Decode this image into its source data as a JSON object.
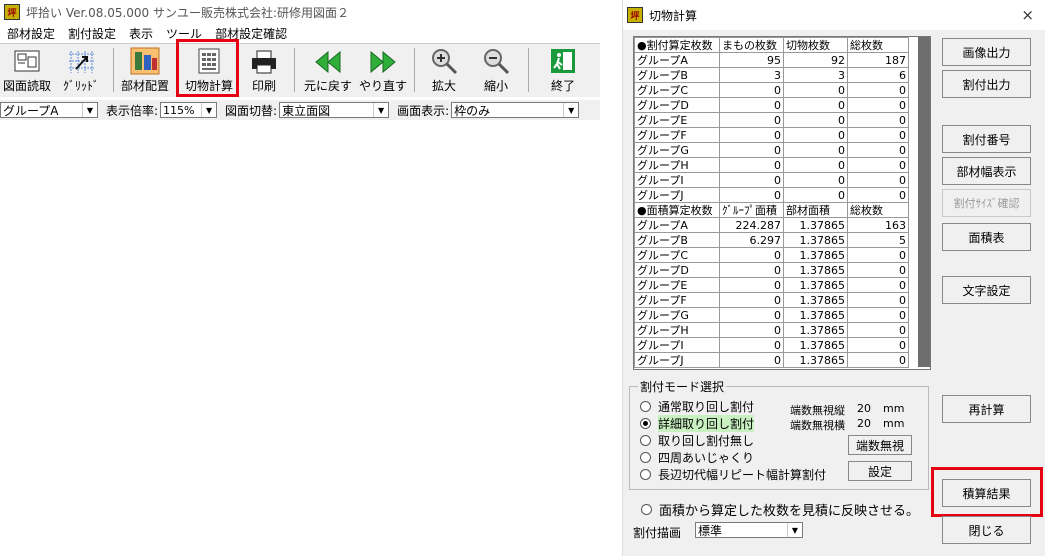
{
  "main": {
    "title": "坪拾い Ver.08.05.000 サンユー販売株式会社:研修用図面２",
    "menu": [
      "部材設定",
      "割付設定",
      "表示",
      "ツール",
      "部材設定確認"
    ],
    "toolbar": {
      "zumen_yomitori": "図面読取",
      "grid": "ｸﾞﾘｯﾄﾞ",
      "buzai_haichi": "部材配置",
      "kiributsu_keisan": "切物計算",
      "insatsu": "印刷",
      "moto_ni_modosu": "元に戻す",
      "yarinaosu": "やり直す",
      "kakudai": "拡大",
      "shukusho": "縮小",
      "shuryo": "終了"
    },
    "group_select": "グループA",
    "scale_label": "表示倍率:",
    "scale_value": "115%",
    "view_switch_label": "図面切替:",
    "view_switch_value": "東立面図",
    "screen_display_label": "画面表示:",
    "screen_display_value": "枠のみ"
  },
  "calc": {
    "title": "切物計算",
    "close": "×",
    "table1": {
      "headers": [
        "●割付算定枚数",
        "まもの枚数",
        "切物枚数",
        "総枚数"
      ],
      "rows": [
        [
          "グループA",
          "95",
          "92",
          "187"
        ],
        [
          "グループB",
          "3",
          "3",
          "6"
        ],
        [
          "グループC",
          "0",
          "0",
          "0"
        ],
        [
          "グループD",
          "0",
          "0",
          "0"
        ],
        [
          "グループE",
          "0",
          "0",
          "0"
        ],
        [
          "グループF",
          "0",
          "0",
          "0"
        ],
        [
          "グループG",
          "0",
          "0",
          "0"
        ],
        [
          "グループH",
          "0",
          "0",
          "0"
        ],
        [
          "グループI",
          "0",
          "0",
          "0"
        ],
        [
          "グループJ",
          "0",
          "0",
          "0"
        ]
      ]
    },
    "table2": {
      "headers": [
        "●面積算定枚数",
        "ｸﾞﾙｰﾌﾟ面積",
        "部材面積",
        "総枚数"
      ],
      "rows": [
        [
          "グループA",
          "224.287",
          "1.37865",
          "163"
        ],
        [
          "グループB",
          "6.297",
          "1.37865",
          "5"
        ],
        [
          "グループC",
          "0",
          "1.37865",
          "0"
        ],
        [
          "グループD",
          "0",
          "1.37865",
          "0"
        ],
        [
          "グループE",
          "0",
          "1.37865",
          "0"
        ],
        [
          "グループF",
          "0",
          "1.37865",
          "0"
        ],
        [
          "グループG",
          "0",
          "1.37865",
          "0"
        ],
        [
          "グループH",
          "0",
          "1.37865",
          "0"
        ],
        [
          "グループI",
          "0",
          "1.37865",
          "0"
        ],
        [
          "グループJ",
          "0",
          "1.37865",
          "0"
        ]
      ]
    },
    "buttons": {
      "image_output": "画像出力",
      "waritsuke_output": "割付出力",
      "waritsuke_number": "割付番号",
      "buzai_width": "部材幅表示",
      "size_check": "割付ｻｲｽﾞ確認",
      "area_table": "面積表",
      "text_settings": "文字設定",
      "recalc": "再計算",
      "estimate_result": "積算結果",
      "close": "閉じる"
    },
    "mode": {
      "title": "割付モード選択",
      "options": [
        "通常取り回し割付",
        "詳細取り回し割付",
        "取り回し割付無し",
        "四周あいじゃくり",
        "長辺切代幅リピート幅計算割付"
      ],
      "selected_index": 1,
      "ignore_v_label": "端数無視縦",
      "ignore_v_value": "20",
      "ignore_h_label": "端数無視横",
      "ignore_h_value": "20",
      "unit": "mm",
      "hasuu_button": "端数無視",
      "settei_button": "設定"
    },
    "reflect_label": "面積から算定した枚数を見積に反映させる。",
    "draw_label": "割付描画",
    "draw_value": "標準"
  },
  "colors": {
    "highlight": "#e60012",
    "selected_radio_bg": "#c8f0c0"
  }
}
